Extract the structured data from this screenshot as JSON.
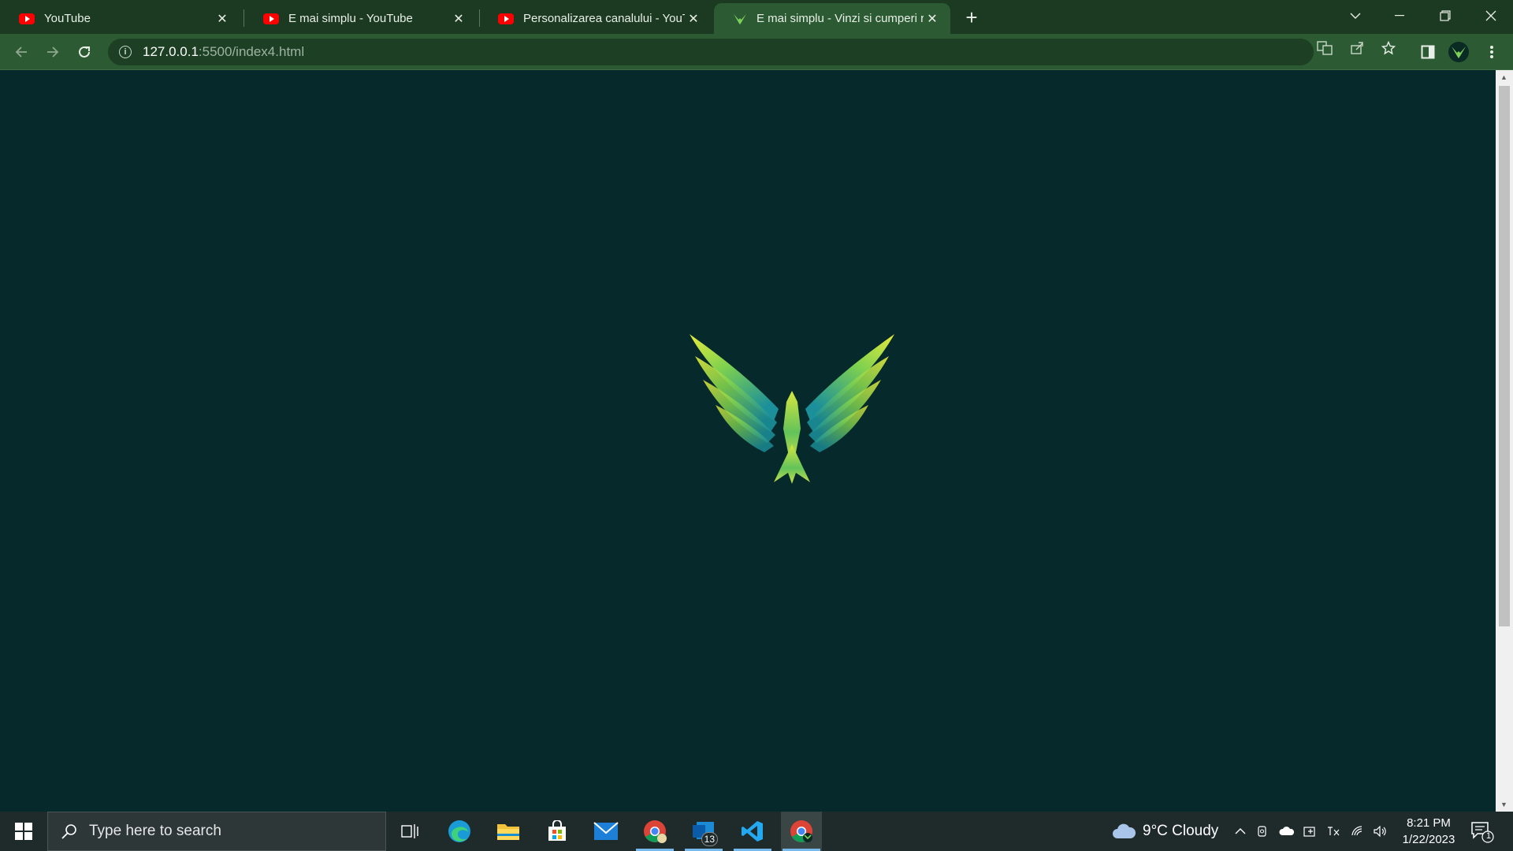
{
  "browser": {
    "tabs": [
      {
        "title": "YouTube",
        "favicon": "youtube-icon",
        "active": false
      },
      {
        "title": "E mai simplu - YouTube",
        "favicon": "youtube-icon",
        "active": false
      },
      {
        "title": "Personalizarea canalului - YouTube",
        "favicon": "youtube-icon",
        "active": false
      },
      {
        "title": "E mai simplu - Vinzi si cumperi rapid",
        "favicon": "bird-icon",
        "active": true
      }
    ],
    "new_tab_label": "+",
    "url_host": "127.0.0.1",
    "url_rest": ":5500/index4.html"
  },
  "taskbar": {
    "search_placeholder": "Type here to search",
    "apps": [
      "task-view-icon",
      "edge-icon",
      "file-explorer-icon",
      "store-icon",
      "mail-icon",
      "chrome-profile-icon",
      "outlook-icon",
      "vscode-icon",
      "chrome-icon"
    ],
    "outlook_badge": "13",
    "weather": "9°C  Cloudy",
    "time": "8:21 PM",
    "date": "1/22/2023",
    "notification_count": "1"
  },
  "colors": {
    "page_background": "#062a2b",
    "browser_frame": "#1c3a21",
    "active_tab": "#2c5a33",
    "logo_top": "#d8e63a",
    "logo_bottom": "#1e9aa0"
  }
}
